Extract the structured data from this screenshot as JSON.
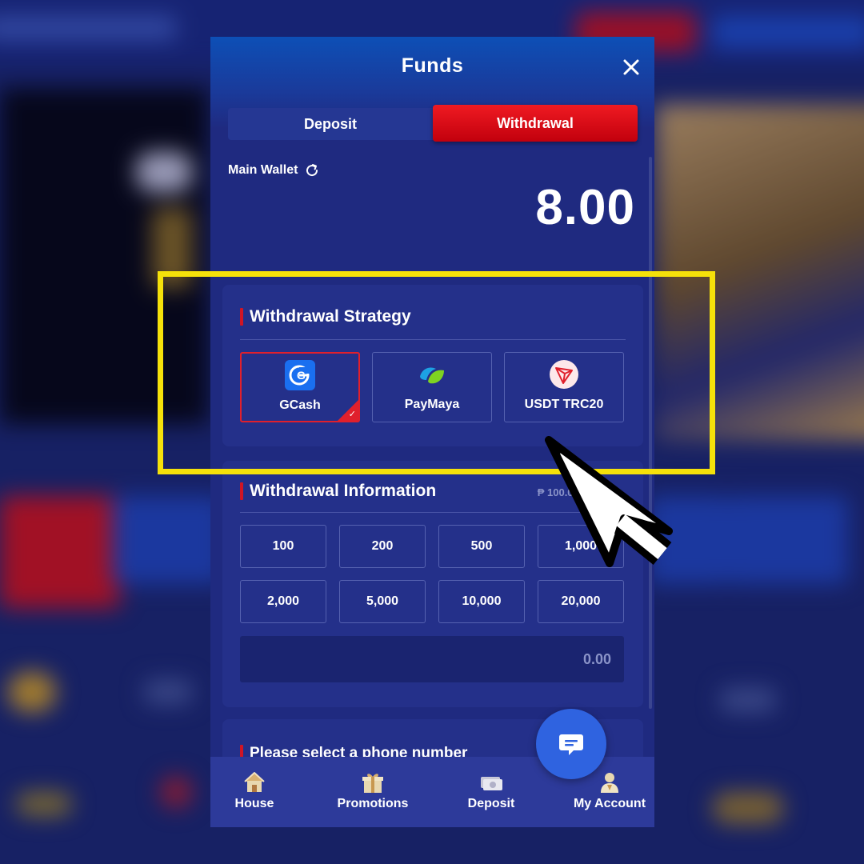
{
  "modal": {
    "title": "Funds",
    "close_icon": "close-icon"
  },
  "tabs": [
    {
      "label": "Deposit",
      "active": false
    },
    {
      "label": "Withdrawal",
      "active": true
    }
  ],
  "wallet": {
    "label": "Main Wallet",
    "refresh_icon": "refresh-icon",
    "amount": "8.00"
  },
  "strategy": {
    "title": "Withdrawal Strategy",
    "methods": [
      {
        "label": "GCash",
        "icon": "gcash-icon",
        "selected": true
      },
      {
        "label": "PayMaya",
        "icon": "paymaya-icon",
        "selected": false
      },
      {
        "label": "USDT TRC20",
        "icon": "tron-icon",
        "selected": false
      }
    ]
  },
  "info": {
    "title": "Withdrawal Information",
    "range": "₱ 100.00 - ₱",
    "amounts": [
      "100",
      "200",
      "500",
      "1,000",
      "2,000",
      "5,000",
      "10,000",
      "20,000"
    ],
    "input_value": "0.00"
  },
  "phone": {
    "title": "Please select a phone number"
  },
  "nav": [
    {
      "label": "House",
      "icon": "house-icon"
    },
    {
      "label": "Promotions",
      "icon": "gift-icon"
    },
    {
      "label": "Deposit",
      "icon": "money-icon"
    },
    {
      "label": "My Account",
      "icon": "user-icon"
    }
  ],
  "colors": {
    "accent_red": "#e0202c",
    "highlight_yellow": "#f5e10a",
    "modal_bg": "#1f2a80"
  }
}
